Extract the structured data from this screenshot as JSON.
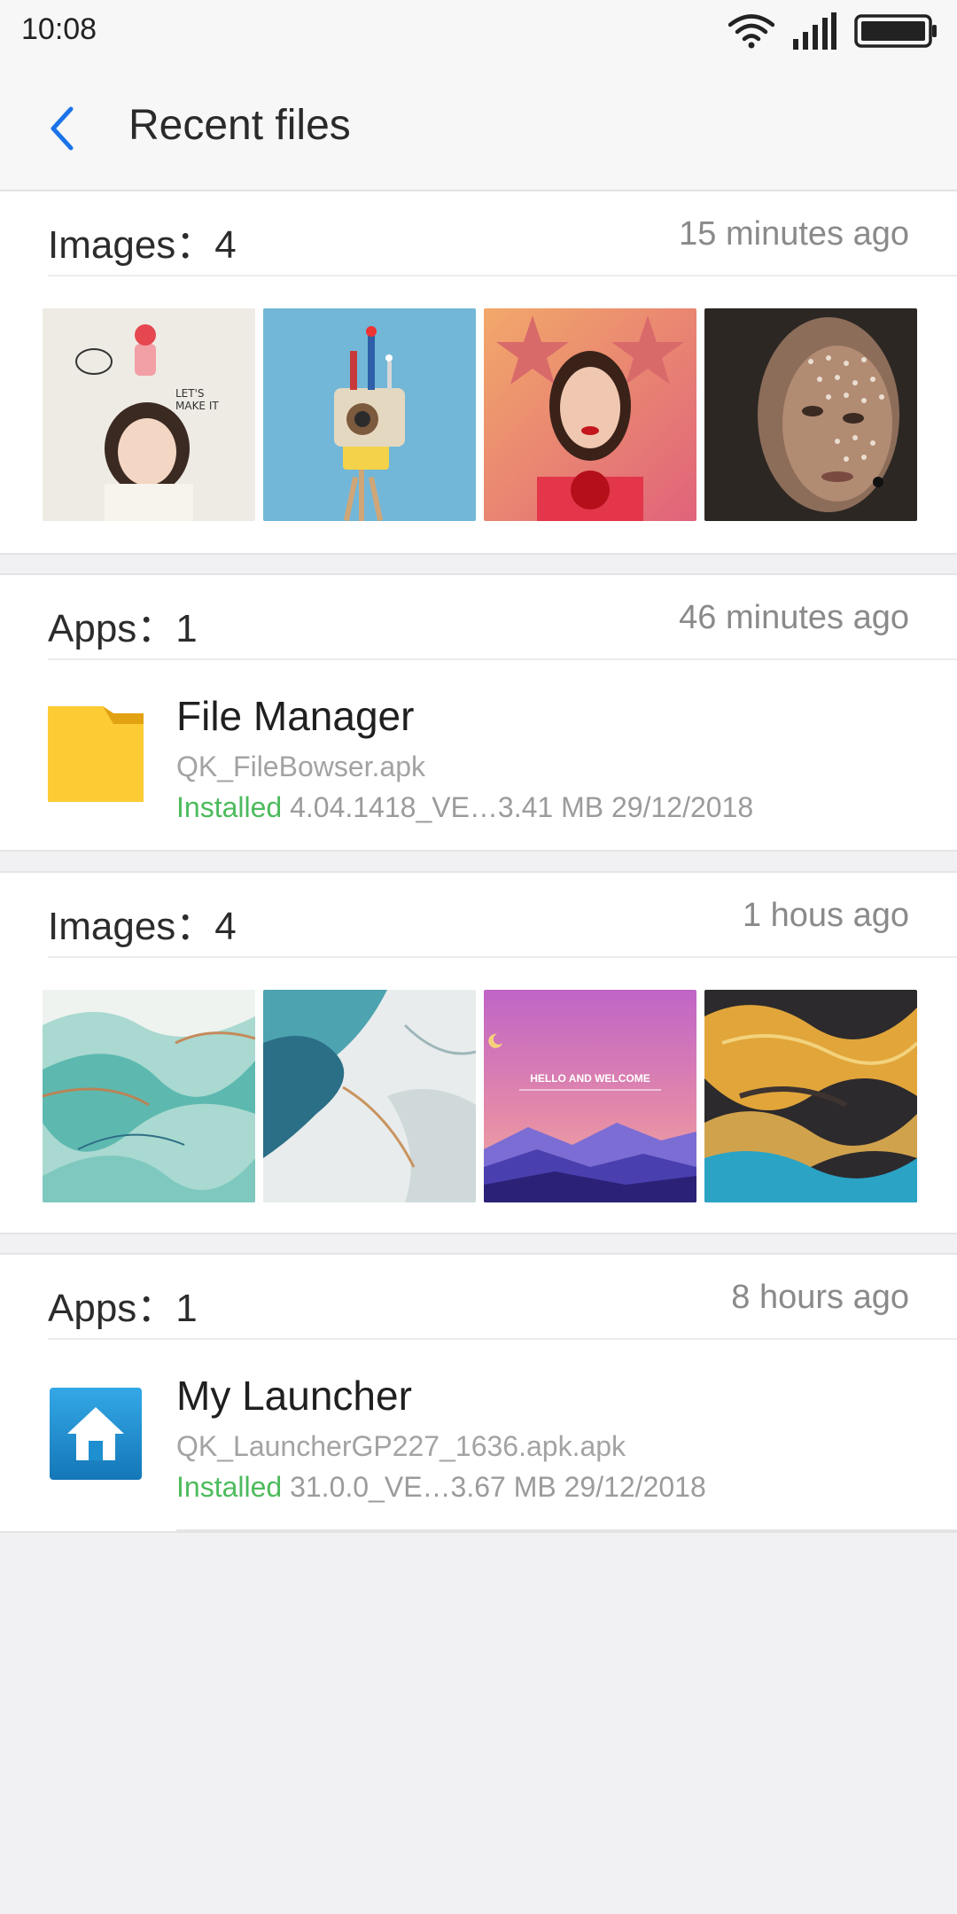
{
  "status_bar": {
    "time": "10:08"
  },
  "header": {
    "title": "Recent files"
  },
  "sections": [
    {
      "kind": "images",
      "title": "Images：4",
      "time": "15 minutes ago",
      "thumbs": [
        {
          "text": "",
          "alt": "girl with cake illustration"
        },
        {
          "text": "",
          "alt": "retro camera toy"
        },
        {
          "text": "",
          "alt": "portrait with star headband"
        },
        {
          "text": "",
          "alt": "face with light dots"
        }
      ]
    },
    {
      "kind": "app",
      "title": "Apps：1",
      "time": "46 minutes ago",
      "app": {
        "name": "File Manager",
        "file": "QK_FileBowser.apk",
        "status": "Installed",
        "details": "4.04.1418_VE…3.41 MB 29/12/2018",
        "icon": "folder-icon"
      }
    },
    {
      "kind": "images",
      "title": "Images：4",
      "time": "1 hous ago",
      "thumbs": [
        {
          "text": "",
          "alt": "teal marble"
        },
        {
          "text": "",
          "alt": "blue marble"
        },
        {
          "text": "HELLO AND WELCOME",
          "alt": "purple mountains wallpaper"
        },
        {
          "text": "",
          "alt": "gold and blue marble"
        }
      ]
    },
    {
      "kind": "app",
      "title": "Apps：1",
      "time": "8 hours ago",
      "app": {
        "name": "My Launcher",
        "file": "QK_LauncherGP227_1636.apk.apk",
        "status": "Installed",
        "details": "31.0.0_VE…3.67 MB 29/12/2018",
        "icon": "home-icon"
      }
    }
  ],
  "colors": {
    "accent": "#1a73e8",
    "installed": "#4cbb5c",
    "folder": "#fdcb33",
    "launcher": "#1e8fd0"
  }
}
